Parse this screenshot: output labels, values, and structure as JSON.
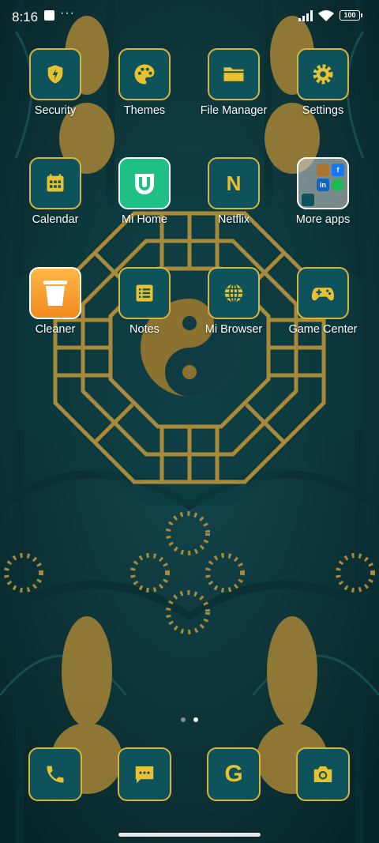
{
  "status_bar": {
    "time": "8:16",
    "more": "···",
    "battery": "100"
  },
  "apps": [
    {
      "label": "Security",
      "icon": "shield-icon"
    },
    {
      "label": "Themes",
      "icon": "palette-icon"
    },
    {
      "label": "File Manager",
      "icon": "folder-icon"
    },
    {
      "label": "Settings",
      "icon": "gear-icon"
    },
    {
      "label": "Calendar",
      "icon": "calendar-icon"
    },
    {
      "label": "Mi Home",
      "icon": "mi-home-icon"
    },
    {
      "label": "Netflix",
      "icon": "netflix-icon",
      "glyph": "N"
    },
    {
      "label": "More apps",
      "icon": "folder-preview-icon"
    },
    {
      "label": "Cleaner",
      "icon": "trash-icon"
    },
    {
      "label": "Notes",
      "icon": "notes-icon"
    },
    {
      "label": "Mi Browser",
      "icon": "globe-icon"
    },
    {
      "label": "Game Center",
      "icon": "gamepad-icon"
    }
  ],
  "folder_preview": {
    "facebook": "f",
    "linkedin": "in"
  },
  "dock": [
    {
      "icon": "phone-icon"
    },
    {
      "icon": "message-icon"
    },
    {
      "icon": "google-icon",
      "glyph": "G"
    },
    {
      "icon": "camera-icon"
    }
  ],
  "pages": {
    "count": 2,
    "active": 2
  },
  "colors": {
    "icon_bg": "#0e535b",
    "icon_border": "#d7b53b",
    "glyph": "#e8c131",
    "wallpaper_dark": "#0d3238",
    "wallpaper_gold": "#a88a3a"
  }
}
